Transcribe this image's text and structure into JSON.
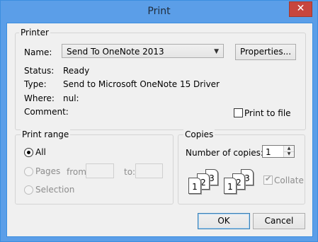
{
  "window": {
    "title": "Print",
    "close_label": "✕"
  },
  "printer": {
    "legend": "Printer",
    "name_label": "Name:",
    "name_value": "Send To OneNote 2013",
    "properties_label": "Properties...",
    "status_label": "Status:",
    "status_value": "Ready",
    "type_label": "Type:",
    "type_value": "Send to Microsoft OneNote 15 Driver",
    "where_label": "Where:",
    "where_value": "nul:",
    "comment_label": "Comment:",
    "print_to_file_label": "Print to file"
  },
  "print_range": {
    "legend": "Print range",
    "all_label": "All",
    "pages_label": "Pages",
    "from_label": "from:",
    "to_label": "to:",
    "selection_label": "Selection"
  },
  "copies": {
    "legend": "Copies",
    "number_label": "Number of copies:",
    "number_value": "1",
    "collate_label": "Collate",
    "pages": [
      "1",
      "2",
      "3"
    ]
  },
  "buttons": {
    "ok_label": "OK",
    "cancel_label": "Cancel"
  },
  "icons": [
    "close-icon",
    "dropdown-arrow-icon",
    "spin-up-icon",
    "spin-down-icon",
    "collate-pages-icon"
  ]
}
